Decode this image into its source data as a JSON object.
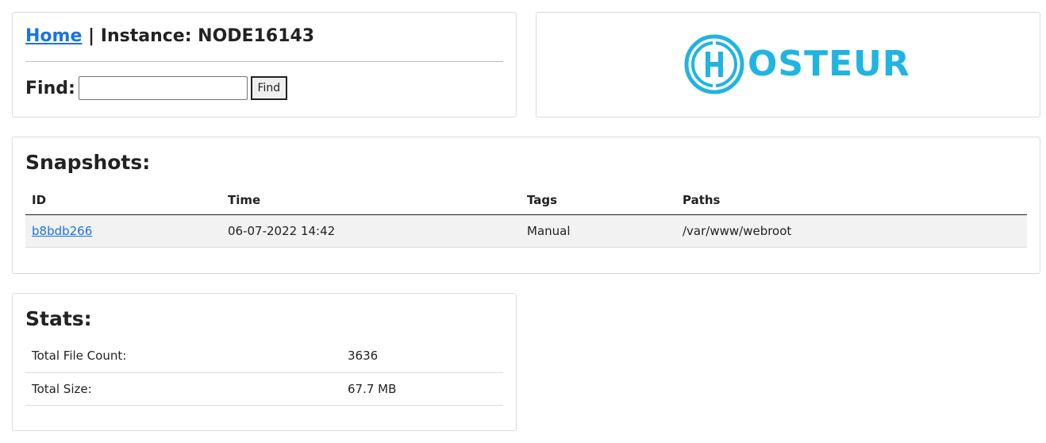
{
  "header": {
    "home_link": "Home",
    "separator": "|",
    "instance_label": "Instance:",
    "instance_id": "NODE16143"
  },
  "find": {
    "label": "Find:",
    "value": "",
    "placeholder": "",
    "button_label": "Find"
  },
  "logo": {
    "letter": "H",
    "text": "OSTEUR",
    "color": "#20b4e0"
  },
  "snapshots": {
    "title": "Snapshots:",
    "columns": [
      "ID",
      "Time",
      "Tags",
      "Paths"
    ],
    "rows": [
      {
        "id": "b8bdb266",
        "time": "06-07-2022 14:42",
        "tags": "Manual",
        "paths": "/var/www/webroot"
      }
    ]
  },
  "stats": {
    "title": "Stats:",
    "rows": [
      {
        "label": "Total File Count:",
        "value": "3636"
      },
      {
        "label": "Total Size:",
        "value": "67.7 MB"
      }
    ]
  },
  "colors": {
    "link": "#1a73e8",
    "logo": "#20b4e0",
    "row_highlight": "#f2f2f2"
  }
}
